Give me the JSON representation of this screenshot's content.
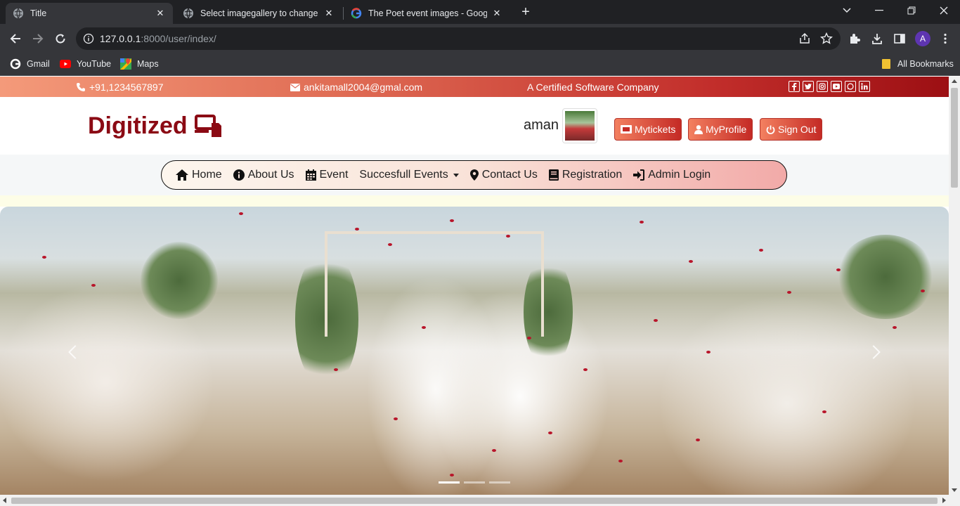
{
  "browser": {
    "tabs": [
      {
        "title": "Title",
        "active": true
      },
      {
        "title": "Select imagegallery to change | D",
        "active": false
      },
      {
        "title": "The Poet event images - Google",
        "active": false
      }
    ],
    "url_host": "127.0.0.1",
    "url_path": ":8000/user/index/",
    "profile_initial": "A",
    "bookmarks": [
      "Gmail",
      "YouTube",
      "Maps"
    ],
    "all_bookmarks": "All Bookmarks"
  },
  "topbar": {
    "phone": "+91,1234567897",
    "email": "ankitamall2004@gmal.com",
    "tagline": "A Certified Software Company",
    "social_icons": [
      "facebook-icon",
      "twitter-icon",
      "instagram-icon",
      "youtube-icon",
      "whatsapp-icon",
      "linkedin-icon"
    ]
  },
  "header": {
    "brand": "Digitized",
    "username": "aman",
    "buttons": [
      "Mytickets",
      "MyProfile",
      "Sign Out"
    ]
  },
  "nav": {
    "items": [
      "Home",
      "About Us",
      "Event",
      "Succesfull Events",
      "Contact Us",
      "Registration",
      "Admin Login"
    ]
  },
  "carousel": {
    "slide_count": 3,
    "active_slide": 1
  },
  "colors": {
    "brand": "#8b0a14",
    "topbar_start": "#f49a7a",
    "topbar_end": "#9c0f13",
    "button": "#c42a25"
  }
}
